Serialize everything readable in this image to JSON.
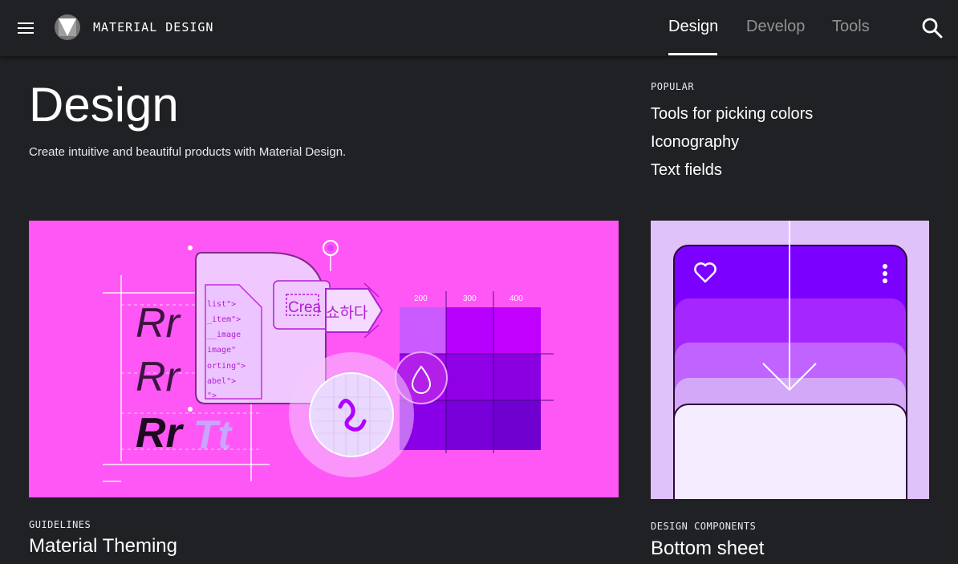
{
  "header": {
    "brand": "MATERIAL DESIGN",
    "tabs": [
      {
        "label": "Design",
        "active": true
      },
      {
        "label": "Develop",
        "active": false
      },
      {
        "label": "Tools",
        "active": false
      }
    ],
    "icons": {
      "menu": "menu-icon",
      "logo": "material-logo-icon",
      "search": "search-icon"
    }
  },
  "hero": {
    "title": "Design",
    "subtitle": "Create intuitive and beautiful products with Material Design."
  },
  "popular": {
    "heading": "POPULAR",
    "links": [
      "Tools for picking colors",
      "Iconography",
      "Text fields"
    ]
  },
  "cards": [
    {
      "label": "GUIDELINES",
      "title": "Material Theming",
      "illustration": {
        "type_samples": [
          "Rr",
          "Rr",
          "Rr",
          "Tt"
        ],
        "code_lines": [
          "list\">",
          "_item\">",
          "__image",
          "image\"",
          "orting\">",
          "abel\">",
          "\">"
        ],
        "chip_text": "Crea",
        "korean_text": "쇼하다",
        "swatch_labels": [
          "200",
          "300",
          "400"
        ]
      }
    },
    {
      "label": "DESIGN COMPONENTS",
      "title": "Bottom sheet"
    }
  ],
  "colors": {
    "background": "#202124",
    "theming_card_bg": "#ff57f5",
    "bottom_sheet_card_bg": "#e0c2fb",
    "purple_primary": "#7c00ff"
  }
}
